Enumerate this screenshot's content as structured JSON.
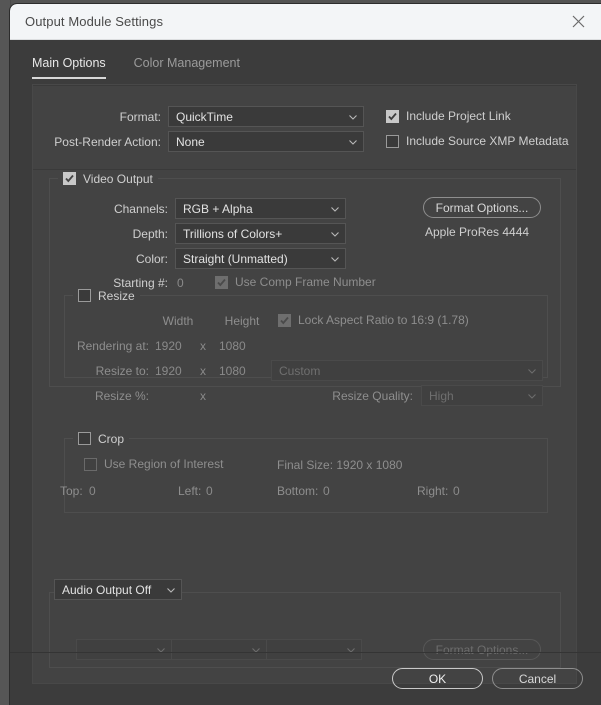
{
  "window": {
    "title": "Output Module Settings",
    "close_icon": "close-icon"
  },
  "tabs": [
    {
      "label": "Main Options",
      "active": true
    },
    {
      "label": "Color Management",
      "active": false
    }
  ],
  "top_section": {
    "format_label": "Format:",
    "format_value": "QuickTime",
    "post_render_label": "Post-Render Action:",
    "post_render_value": "None",
    "include_project_link_label": "Include Project Link",
    "include_project_link_checked": true,
    "include_xmp_label": "Include Source XMP Metadata",
    "include_xmp_checked": false
  },
  "video_output": {
    "legend": "Video Output",
    "enabled": true,
    "channels_label": "Channels:",
    "channels_value": "RGB + Alpha",
    "depth_label": "Depth:",
    "depth_value": "Trillions of Colors+",
    "color_label": "Color:",
    "color_value": "Straight (Unmatted)",
    "starting_label": "Starting #:",
    "starting_value": "0",
    "use_comp_frame_label": "Use Comp Frame Number",
    "use_comp_frame_checked": true,
    "format_options_label": "Format Options...",
    "codec_text": "Apple ProRes 4444"
  },
  "resize": {
    "legend": "Resize",
    "enabled": false,
    "width_header": "Width",
    "height_header": "Height",
    "lock_aspect_label": "Lock Aspect Ratio to 16:9 (1.78)",
    "lock_aspect_checked": true,
    "rendering_at_label": "Rendering at:",
    "rendering_width": "1920",
    "rendering_x": "x",
    "rendering_height": "1080",
    "resize_to_label": "Resize to:",
    "resize_width": "1920",
    "resize_x": "x",
    "resize_height": "1080",
    "resize_preset": "Custom",
    "resize_pct_label": "Resize %:",
    "resize_pct_x": "x",
    "resize_quality_label": "Resize Quality:",
    "resize_quality_value": "High"
  },
  "crop": {
    "legend": "Crop",
    "enabled": false,
    "use_roi_label": "Use Region of Interest",
    "use_roi_checked": false,
    "final_size_text": "Final Size: 1920 x 1080",
    "top_label": "Top:",
    "top_value": "0",
    "left_label": "Left:",
    "left_value": "0",
    "bottom_label": "Bottom:",
    "bottom_value": "0",
    "right_label": "Right:",
    "right_value": "0"
  },
  "audio_output": {
    "legend_value": "Audio Output Off",
    "enabled": false,
    "rate_value": "",
    "depth_value": "",
    "channels_value": "",
    "format_options_label": "Format Options..."
  },
  "footer": {
    "ok_label": "OK",
    "cancel_label": "Cancel"
  }
}
